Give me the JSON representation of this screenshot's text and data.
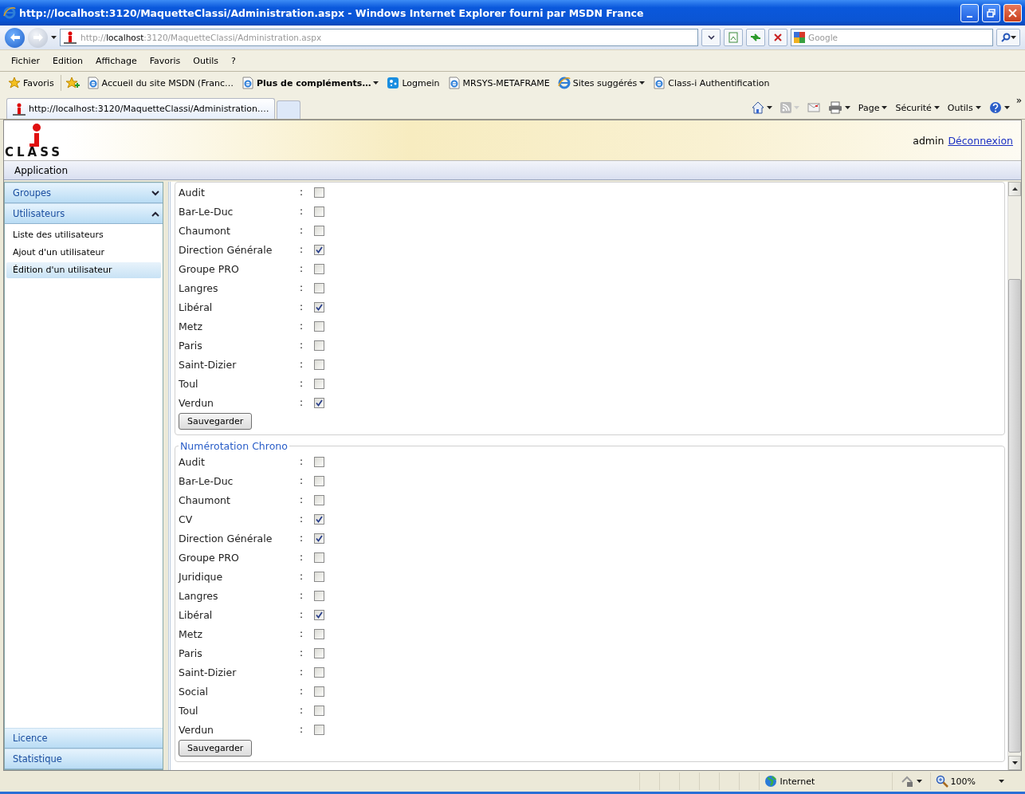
{
  "window": {
    "title": "http://localhost:3120/MaquetteClassi/Administration.aspx - Windows Internet Explorer fourni par MSDN France"
  },
  "address_bar": {
    "scheme": "http://",
    "host": "localhost",
    "path": ":3120/MaquetteClassi/Administration.aspx"
  },
  "search": {
    "placeholder": "Google"
  },
  "menu": [
    "Fichier",
    "Edition",
    "Affichage",
    "Favoris",
    "Outils",
    "?"
  ],
  "favorites": {
    "label": "Favoris",
    "links": [
      {
        "label": "Accueil du site MSDN (Franc…",
        "kind": "ie",
        "bold": false,
        "dropdown": false
      },
      {
        "label": "Plus de compléments…",
        "kind": "ie",
        "bold": true,
        "dropdown": true
      },
      {
        "label": "Logmein",
        "kind": "logmein",
        "bold": false,
        "dropdown": false
      },
      {
        "label": "MRSYS-METAFRAME",
        "kind": "ie",
        "bold": false,
        "dropdown": false
      },
      {
        "label": "Sites suggérés",
        "kind": "ie-color",
        "bold": false,
        "dropdown": true
      },
      {
        "label": "Class-i Authentification",
        "kind": "ie",
        "bold": false,
        "dropdown": false
      }
    ]
  },
  "tabs": [
    {
      "label": "http://localhost:3120/MaquetteClassi/Administration.…",
      "selected": true
    }
  ],
  "commands": [
    "Page",
    "Sécurité",
    "Outils"
  ],
  "command_overflow": "»",
  "page": {
    "logo": "CLASS",
    "user": "admin",
    "logout": "Déconnexion",
    "app_menu": "Application"
  },
  "sidebar": {
    "sections": [
      {
        "label": "Groupes",
        "expanded": false
      },
      {
        "label": "Utilisateurs",
        "expanded": true,
        "items": [
          {
            "label": "Liste des utilisateurs",
            "selected": false
          },
          {
            "label": "Ajout d'un utilisateur",
            "selected": false
          },
          {
            "label": "Édition d'un utilisateur",
            "selected": true
          }
        ]
      }
    ],
    "bottom_sections": [
      "Licence",
      "Statistique"
    ]
  },
  "fieldsets": [
    {
      "rows": [
        {
          "label": "Audit",
          "separator": ":",
          "checked": false
        },
        {
          "label": "Bar-Le-Duc",
          "separator": ":",
          "checked": false
        },
        {
          "label": "Chaumont",
          "separator": ":",
          "checked": false
        },
        {
          "label": "Direction Générale",
          "separator": ":",
          "checked": true
        },
        {
          "label": "Groupe PRO",
          "separator": ":",
          "checked": false
        },
        {
          "label": "Langres",
          "separator": ":",
          "checked": false
        },
        {
          "label": "Libéral",
          "separator": ":",
          "checked": true
        },
        {
          "label": "Metz",
          "separator": ":",
          "checked": false
        },
        {
          "label": "Paris",
          "separator": ":",
          "checked": false
        },
        {
          "label": "Saint-Dizier",
          "separator": ":",
          "checked": false
        },
        {
          "label": "Toul",
          "separator": ":",
          "checked": false
        },
        {
          "label": "Verdun",
          "separator": ":",
          "checked": true
        }
      ],
      "button": "Sauvegarder"
    },
    {
      "legend": "Numérotation Chrono",
      "rows": [
        {
          "label": "Audit",
          "separator": ":",
          "checked": false
        },
        {
          "label": "Bar-Le-Duc",
          "separator": ":",
          "checked": false
        },
        {
          "label": "Chaumont",
          "separator": ":",
          "checked": false
        },
        {
          "label": "CV",
          "separator": ":",
          "checked": true
        },
        {
          "label": "Direction Générale",
          "separator": ":",
          "checked": true
        },
        {
          "label": "Groupe PRO",
          "separator": ":",
          "checked": false
        },
        {
          "label": "Juridique",
          "separator": ":",
          "checked": false
        },
        {
          "label": "Langres",
          "separator": ":",
          "checked": false
        },
        {
          "label": "Libéral",
          "separator": ":",
          "checked": true
        },
        {
          "label": "Metz",
          "separator": ":",
          "checked": false
        },
        {
          "label": "Paris",
          "separator": ":",
          "checked": false
        },
        {
          "label": "Saint-Dizier",
          "separator": ":",
          "checked": false
        },
        {
          "label": "Social",
          "separator": ":",
          "checked": false
        },
        {
          "label": "Toul",
          "separator": ":",
          "checked": false
        },
        {
          "label": "Verdun",
          "separator": ":",
          "checked": false
        }
      ],
      "button": "Sauvegarder"
    }
  ],
  "status_bar": {
    "zone": "Internet",
    "zoom": "100%"
  }
}
